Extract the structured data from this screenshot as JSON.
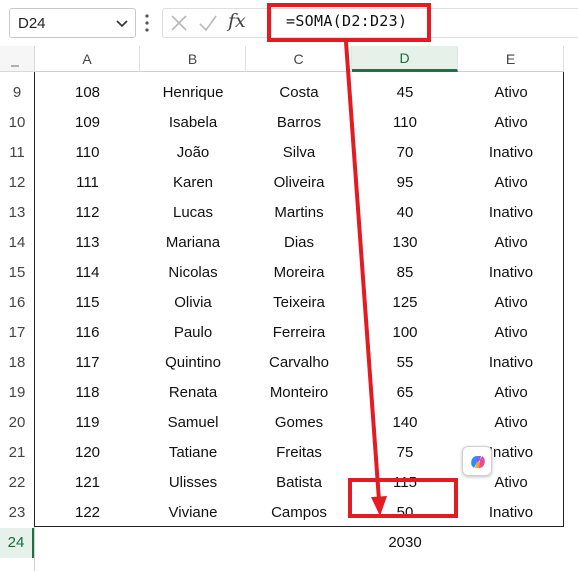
{
  "formula_bar": {
    "name_box": "D24",
    "formula": "=SOMA(D2:D23)",
    "fx_label": "fx",
    "highlight_color": "#e31b23"
  },
  "grid": {
    "columns": [
      "A",
      "B",
      "C",
      "D",
      "E"
    ],
    "selected_column": "D",
    "selected_row": "24",
    "rows": [
      {
        "n": "9",
        "cells": [
          "108",
          "Henrique",
          "Costa",
          "45",
          "Ativo"
        ]
      },
      {
        "n": "10",
        "cells": [
          "109",
          "Isabela",
          "Barros",
          "110",
          "Ativo"
        ]
      },
      {
        "n": "11",
        "cells": [
          "110",
          "João",
          "Silva",
          "70",
          "Inativo"
        ]
      },
      {
        "n": "12",
        "cells": [
          "111",
          "Karen",
          "Oliveira",
          "95",
          "Ativo"
        ]
      },
      {
        "n": "13",
        "cells": [
          "112",
          "Lucas",
          "Martins",
          "40",
          "Inativo"
        ]
      },
      {
        "n": "14",
        "cells": [
          "113",
          "Mariana",
          "Dias",
          "130",
          "Ativo"
        ]
      },
      {
        "n": "15",
        "cells": [
          "114",
          "Nicolas",
          "Moreira",
          "85",
          "Inativo"
        ]
      },
      {
        "n": "16",
        "cells": [
          "115",
          "Olivia",
          "Teixeira",
          "125",
          "Ativo"
        ]
      },
      {
        "n": "17",
        "cells": [
          "116",
          "Paulo",
          "Ferreira",
          "100",
          "Ativo"
        ]
      },
      {
        "n": "18",
        "cells": [
          "117",
          "Quintino",
          "Carvalho",
          "55",
          "Inativo"
        ]
      },
      {
        "n": "19",
        "cells": [
          "118",
          "Renata",
          "Monteiro",
          "65",
          "Ativo"
        ]
      },
      {
        "n": "20",
        "cells": [
          "119",
          "Samuel",
          "Gomes",
          "140",
          "Ativo"
        ]
      },
      {
        "n": "21",
        "cells": [
          "120",
          "Tatiane",
          "Freitas",
          "75",
          "Inativo"
        ]
      },
      {
        "n": "22",
        "cells": [
          "121",
          "Ulisses",
          "Batista",
          "115",
          "Ativo"
        ]
      },
      {
        "n": "23",
        "cells": [
          "122",
          "Viviane",
          "Campos",
          "50",
          "Inativo"
        ]
      },
      {
        "n": "24",
        "cells": [
          "",
          "",
          "",
          "2030",
          ""
        ]
      }
    ]
  },
  "icons": {
    "name_box_dropdown": "chevron-down-icon",
    "more": "vertical-dots-icon",
    "cancel": "cancel-x-icon",
    "enter": "checkmark-icon",
    "copilot": "copilot-icon"
  }
}
